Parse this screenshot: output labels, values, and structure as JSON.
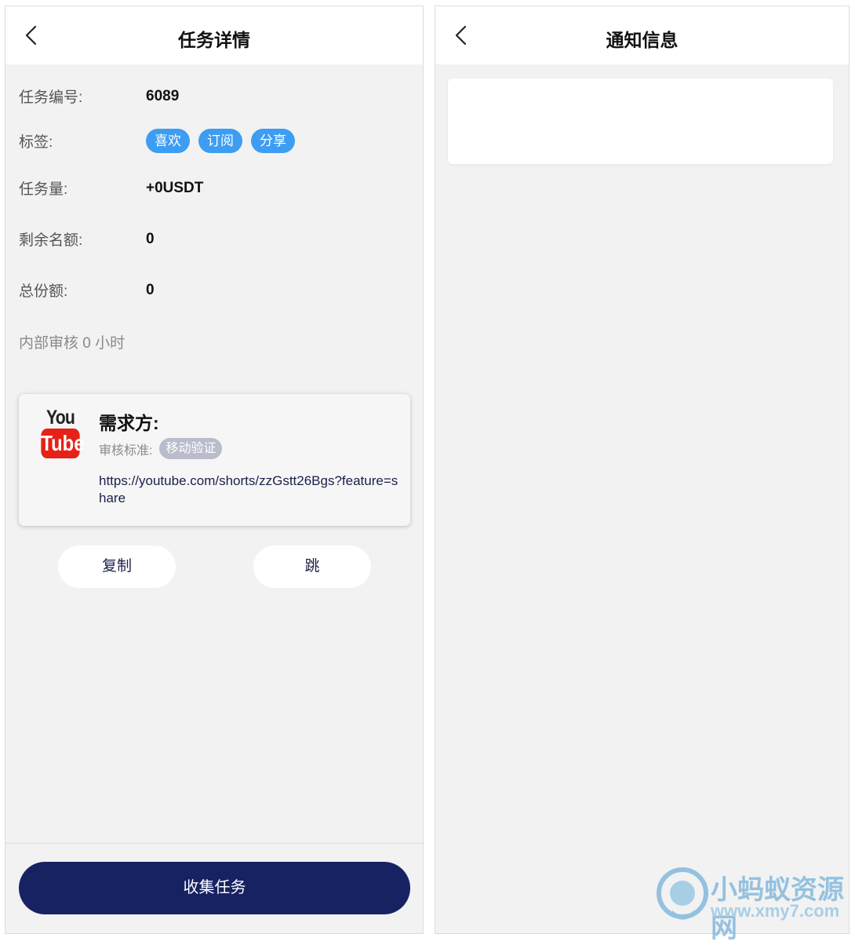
{
  "task_screen": {
    "header": {
      "title": "任务详情"
    },
    "fields": {
      "task_id": {
        "label": "任务编号:",
        "value": "6089"
      },
      "tags": {
        "label": "标签:",
        "items": [
          "喜欢",
          "订阅",
          "分享"
        ]
      },
      "task_amount": {
        "label": "任务量:",
        "value": "+0USDT"
      },
      "remaining": {
        "label": "剩余名额:",
        "value": "0"
      },
      "total": {
        "label": "总份额:",
        "value": "0"
      }
    },
    "review_note": "内部审核 0 小时",
    "card": {
      "logo_top": "You",
      "logo_bottom": "Tube",
      "title": "需求方:",
      "standard_label": "审核标准:",
      "standard_value": "移动验证",
      "link": "https://youtube.com/shorts/zzGstt26Bgs?feature=share"
    },
    "buttons": {
      "copy": "复制",
      "jump": "跳"
    },
    "collect_button": "收集任务"
  },
  "notice_screen": {
    "header": {
      "title": "通知信息"
    }
  },
  "watermark": {
    "title": "小蚂蚁资源网",
    "url": "www.xmy7.com"
  },
  "colors": {
    "tag_blue": "#3d9df2",
    "navy": "#172263",
    "youtube_red": "#e62117",
    "badge_gray": "#b8bccb",
    "background": "#f2f2f2"
  },
  "icons": [
    "back-chevron-icon",
    "youtube-logo",
    "watermark-logo-icon"
  ]
}
